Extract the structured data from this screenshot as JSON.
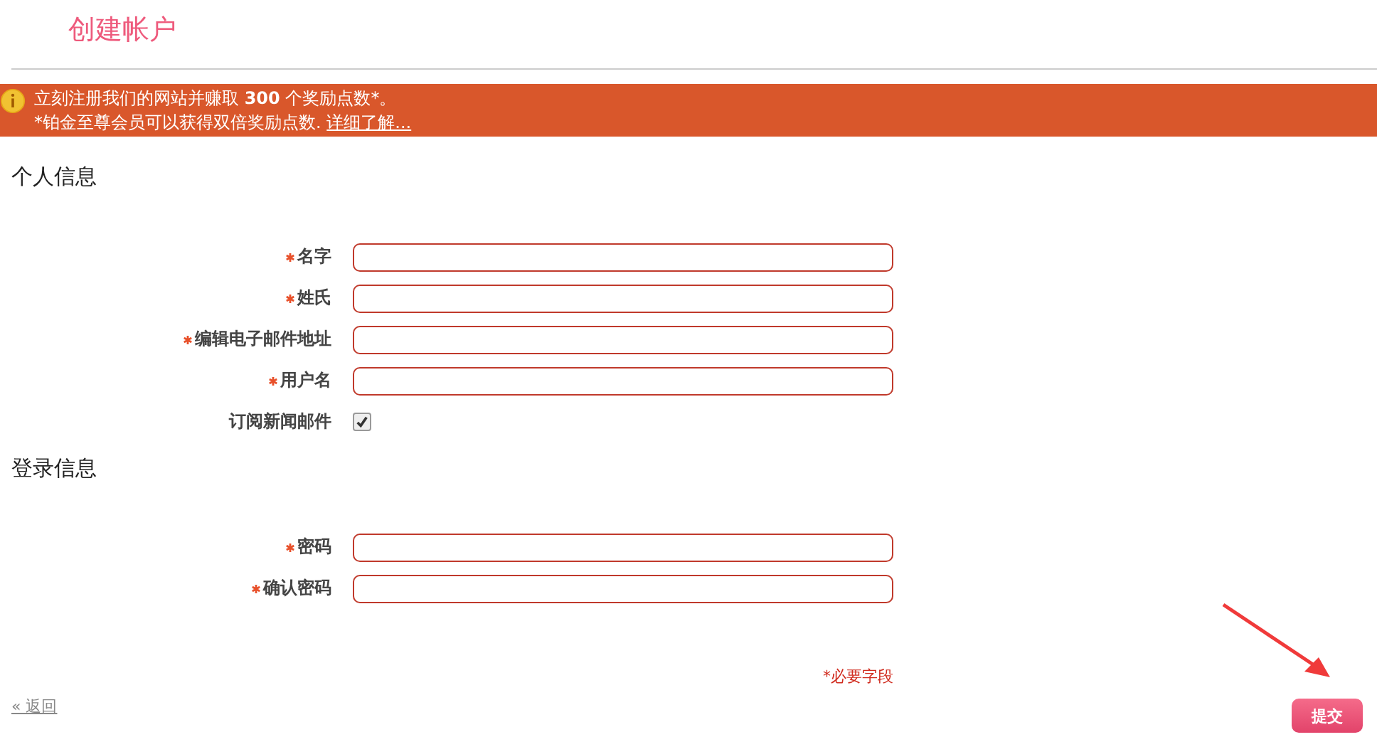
{
  "page_title": "创建帐户",
  "banner": {
    "headline": "立刻注册我们的网站并赚取 **300** 个奖励点数*。",
    "note": "*铂金至尊会员可以获得双倍奖励点数.",
    "link": "详细了解..."
  },
  "sections": [
    {
      "title": "个人信息",
      "fields": [
        {
          "kind": "text",
          "label": "名字",
          "required": true
        },
        {
          "kind": "text",
          "label": "姓氏",
          "required": true
        },
        {
          "kind": "text",
          "label": "编辑电子邮件地址",
          "required": true
        },
        {
          "kind": "text",
          "label": "用户名",
          "required": true
        },
        {
          "kind": "checkbox",
          "label": "订阅新闻邮件",
          "required": false,
          "checked": true
        }
      ]
    },
    {
      "title": "登录信息",
      "fields": [
        {
          "kind": "password",
          "label": "密码",
          "required": true
        },
        {
          "kind": "password",
          "label": "确认密码",
          "required": true
        }
      ]
    }
  ],
  "required_note": "*必要字段",
  "back_link": "« 返回",
  "submit_button": "提交"
}
